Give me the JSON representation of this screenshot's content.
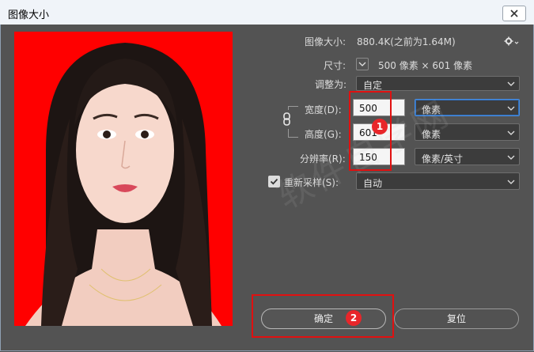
{
  "window": {
    "title": "图像大小"
  },
  "info": {
    "image_size_label": "图像大小:",
    "image_size_value": "880.4K(之前为1.64M)",
    "dimensions_label": "尺寸:",
    "dimensions_value": "500 像素  ×  601 像素",
    "fit_to_label": "调整为:",
    "fit_to_value": "自定"
  },
  "fields": {
    "width_label": "宽度(D):",
    "width_value": "500",
    "width_unit": "像素",
    "height_label": "高度(G):",
    "height_value": "601",
    "height_unit": "像素",
    "resolution_label": "分辨率(R):",
    "resolution_value": "150",
    "resolution_unit": "像素/英寸",
    "resample_label": "重新采样(S):",
    "resample_value": "自动"
  },
  "buttons": {
    "ok": "确定",
    "reset": "复位"
  },
  "annotations": {
    "badge1": "1",
    "badge2": "2"
  },
  "watermark": "软件自学网",
  "colors": {
    "preview_bg": "#ff0000",
    "annotation_red": "#e01010",
    "dialog_bg": "#535353"
  },
  "icons": [
    "close-icon",
    "gear-icon",
    "chevron-down-icon",
    "link-icon",
    "checkmark-icon"
  ]
}
